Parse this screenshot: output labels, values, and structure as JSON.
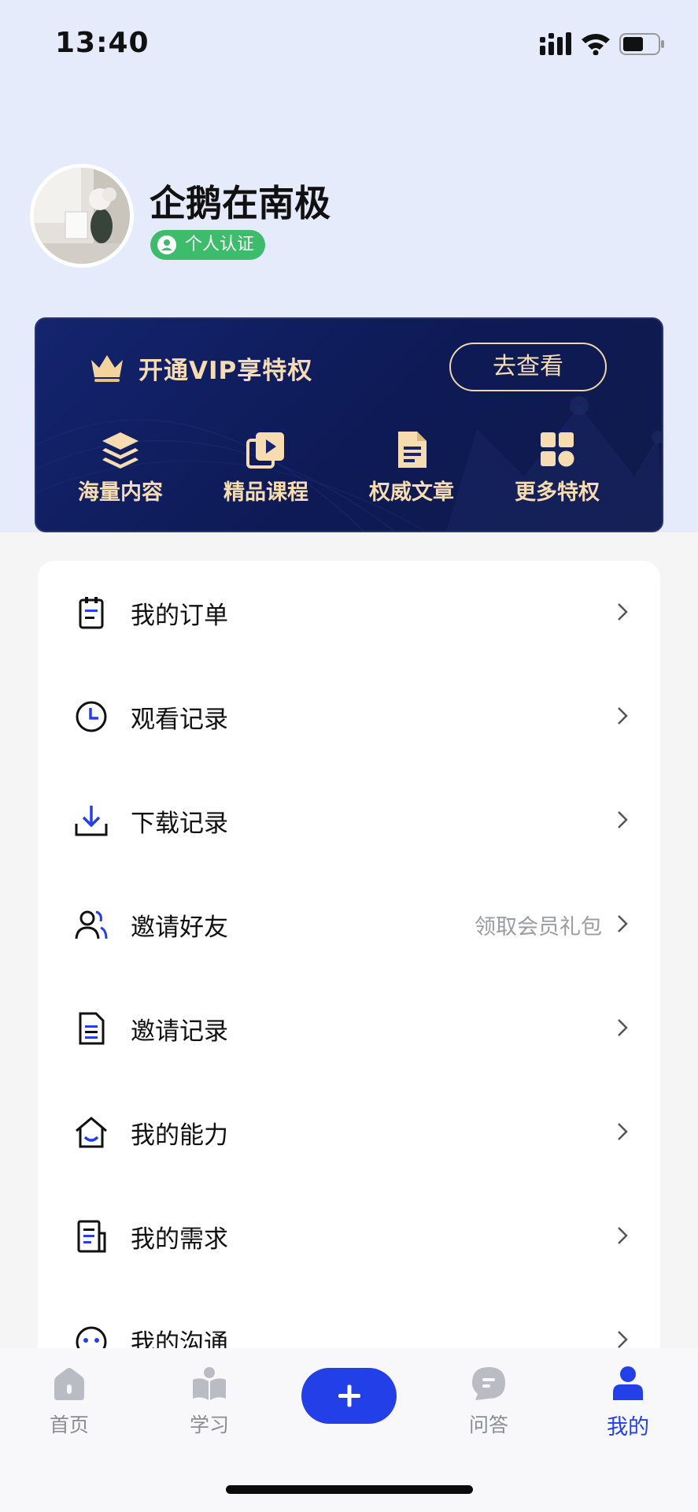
{
  "status_bar": {
    "time": "13:40"
  },
  "profile": {
    "username": "企鹅在南极",
    "verify_badge": "个人认证"
  },
  "vip": {
    "title": "开通VIP享特权",
    "button": "去查看",
    "perks": [
      {
        "label": "海量内容",
        "icon": "layers-icon"
      },
      {
        "label": "精品课程",
        "icon": "video-course-icon"
      },
      {
        "label": "权威文章",
        "icon": "document-icon"
      },
      {
        "label": "更多特权",
        "icon": "grid-icon"
      }
    ]
  },
  "menu": {
    "items": [
      {
        "label": "我的订单",
        "icon": "order-clipboard-icon",
        "extra": ""
      },
      {
        "label": "观看记录",
        "icon": "clock-icon",
        "extra": ""
      },
      {
        "label": "下载记录",
        "icon": "download-icon",
        "extra": ""
      },
      {
        "label": "邀请好友",
        "icon": "friends-icon",
        "extra": "领取会员礼包"
      },
      {
        "label": "邀请记录",
        "icon": "record-file-icon",
        "extra": ""
      },
      {
        "label": "我的能力",
        "icon": "house-smile-icon",
        "extra": ""
      },
      {
        "label": "我的需求",
        "icon": "request-doc-icon",
        "extra": ""
      },
      {
        "label": "我的沟通",
        "icon": "chat-face-icon",
        "extra": ""
      }
    ]
  },
  "tabbar": {
    "tabs": [
      {
        "label": "首页",
        "icon": "home-icon",
        "active": false
      },
      {
        "label": "学习",
        "icon": "study-icon",
        "active": false
      },
      {
        "label": "",
        "icon": "plus-icon",
        "active": false
      },
      {
        "label": "问答",
        "icon": "qa-bubble-icon",
        "active": false
      },
      {
        "label": "我的",
        "icon": "person-icon",
        "active": true
      }
    ]
  },
  "colors": {
    "accent": "#2340e8",
    "vip_gold": "#f6dcb0",
    "vip_bg": "#0d1a55",
    "verify_green": "#3dbd6c",
    "header_bg": "#e6ebfc"
  }
}
